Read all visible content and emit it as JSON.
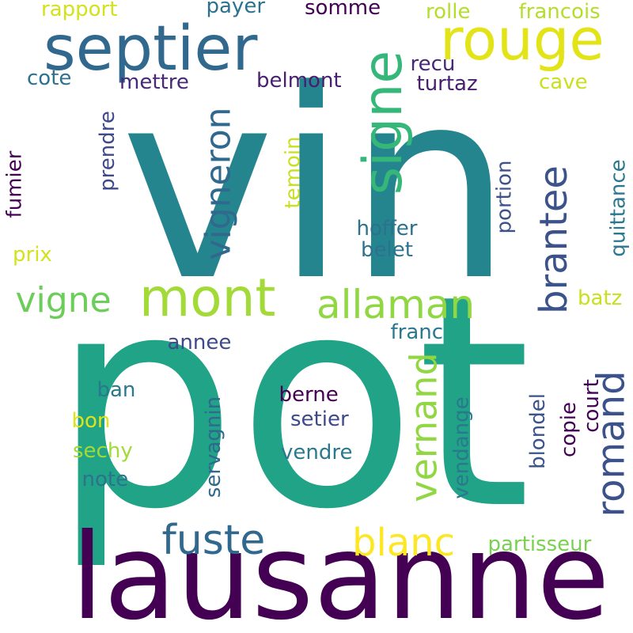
{
  "words": [
    {
      "text": "vin",
      "color": "#25858e",
      "vertical": false
    },
    {
      "text": "pot",
      "color": "#20a386",
      "vertical": false
    },
    {
      "text": "lausanne",
      "color": "#440154",
      "vertical": false
    },
    {
      "text": "septier",
      "color": "#31688e",
      "vertical": false
    },
    {
      "text": "rouge",
      "color": "#e2e418",
      "vertical": false
    },
    {
      "text": "signe",
      "color": "#35b779",
      "vertical": true
    },
    {
      "text": "mont",
      "color": "#a2da37",
      "vertical": false
    },
    {
      "text": "vigneron",
      "color": "#31688e",
      "vertical": true
    },
    {
      "text": "allaman",
      "color": "#90d743",
      "vertical": false
    },
    {
      "text": "brantee",
      "color": "#3b528b",
      "vertical": true
    },
    {
      "text": "vigne",
      "color": "#6ccd5a",
      "vertical": false
    },
    {
      "text": "vernand",
      "color": "#90d743",
      "vertical": true
    },
    {
      "text": "romand",
      "color": "#3b528b",
      "vertical": true
    },
    {
      "text": "fuste",
      "color": "#31688e",
      "vertical": false
    },
    {
      "text": "blanc",
      "color": "#fde725",
      "vertical": false
    },
    {
      "text": "rapport",
      "color": "#d2e21b",
      "vertical": false
    },
    {
      "text": "payer",
      "color": "#2c728e",
      "vertical": false
    },
    {
      "text": "somme",
      "color": "#440154",
      "vertical": false
    },
    {
      "text": "rolle",
      "color": "#b5de2b",
      "vertical": false
    },
    {
      "text": "francois",
      "color": "#b5de2b",
      "vertical": false
    },
    {
      "text": "recu",
      "color": "#482878",
      "vertical": false
    },
    {
      "text": "cote",
      "color": "#2c728e",
      "vertical": false
    },
    {
      "text": "mettre",
      "color": "#482878",
      "vertical": false
    },
    {
      "text": "belmont",
      "color": "#481f70",
      "vertical": false
    },
    {
      "text": "turtaz",
      "color": "#481f70",
      "vertical": false
    },
    {
      "text": "cave",
      "color": "#c8e020",
      "vertical": false
    },
    {
      "text": "fumier",
      "color": "#440154",
      "vertical": true
    },
    {
      "text": "prendre",
      "color": "#3e4989",
      "vertical": true
    },
    {
      "text": "temoin",
      "color": "#c8e020",
      "vertical": true
    },
    {
      "text": "quittance",
      "color": "#2a788e",
      "vertical": true
    },
    {
      "text": "portion",
      "color": "#3b528b",
      "vertical": true
    },
    {
      "text": "hoffer",
      "color": "#2c728e",
      "vertical": false
    },
    {
      "text": "belet",
      "color": "#2c728e",
      "vertical": false
    },
    {
      "text": "prix",
      "color": "#d2e21b",
      "vertical": false
    },
    {
      "text": "batz",
      "color": "#c8e020",
      "vertical": false
    },
    {
      "text": "franc",
      "color": "#2a788e",
      "vertical": false
    },
    {
      "text": "annee",
      "color": "#3e4989",
      "vertical": false
    },
    {
      "text": "ban",
      "color": "#2a788e",
      "vertical": false
    },
    {
      "text": "berne",
      "color": "#440154",
      "vertical": false
    },
    {
      "text": "setier",
      "color": "#3e4989",
      "vertical": false
    },
    {
      "text": "bon",
      "color": "#dde318",
      "vertical": false
    },
    {
      "text": "sechy",
      "color": "#a2da37",
      "vertical": false
    },
    {
      "text": "vendre",
      "color": "#2a788e",
      "vertical": false
    },
    {
      "text": "note",
      "color": "#2c728e",
      "vertical": false
    },
    {
      "text": "servagnin",
      "color": "#31688e",
      "vertical": true
    },
    {
      "text": "vendange",
      "color": "#2a788e",
      "vertical": true
    },
    {
      "text": "blondel",
      "color": "#3b528b",
      "vertical": true
    },
    {
      "text": "copie",
      "color": "#440154",
      "vertical": true
    },
    {
      "text": "court",
      "color": "#440154",
      "vertical": true
    },
    {
      "text": "partisseur",
      "color": "#7ad151",
      "vertical": false
    }
  ]
}
